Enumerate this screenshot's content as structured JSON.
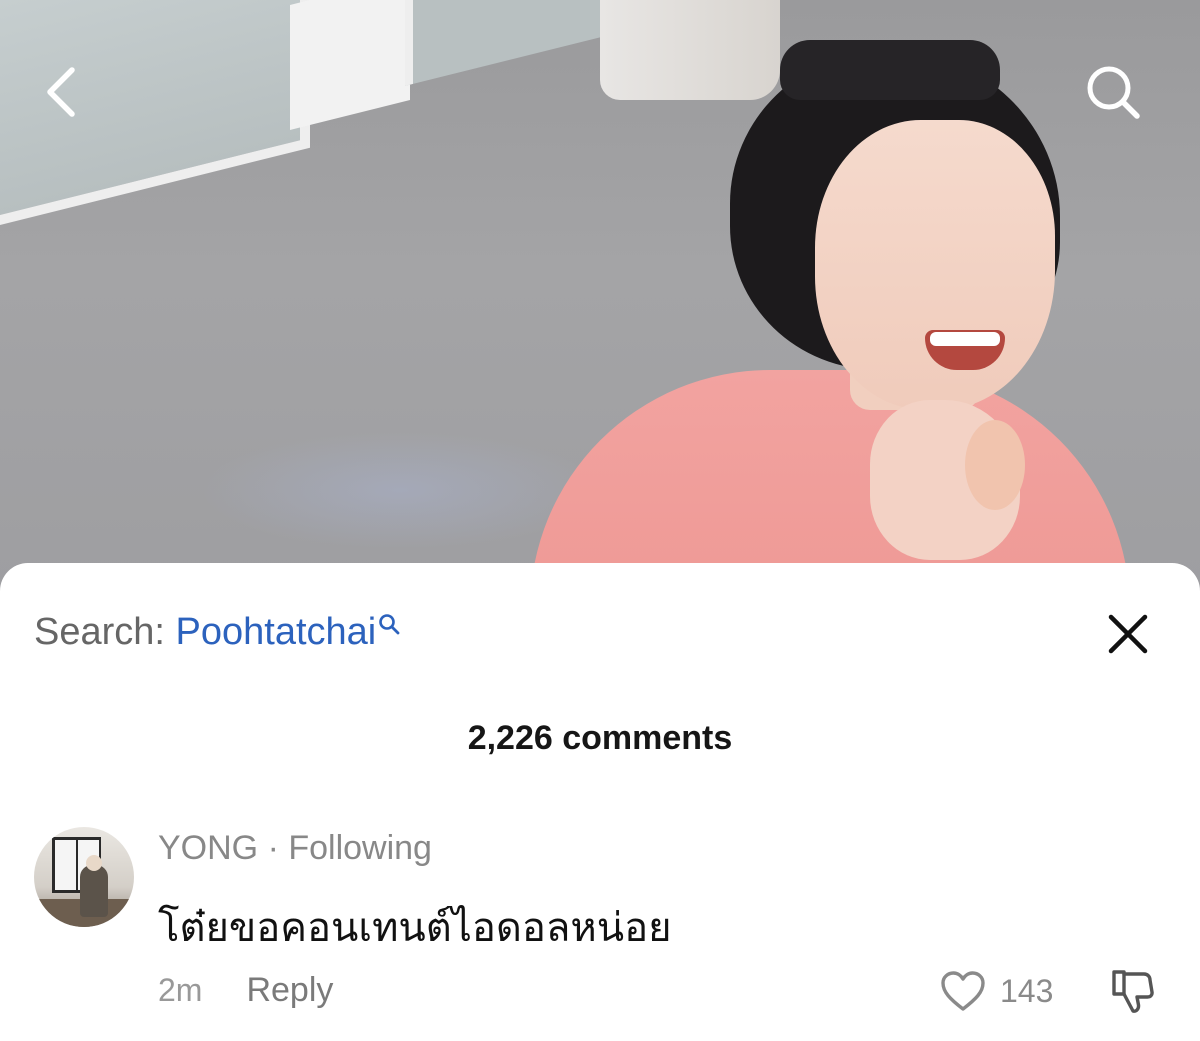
{
  "video": {
    "icons": {
      "back": "chevron-left-icon",
      "search": "search-icon"
    }
  },
  "sheet": {
    "search_prefix": "Search: ",
    "search_term": "Poohtatchai",
    "comment_count": "2,226 comments",
    "comment": {
      "username": "YONG",
      "separator": " · ",
      "relationship": "Following",
      "text": "โต๋ยขอคอนเทนต์ไอดอลหน่อย",
      "time": "2m",
      "reply_label": "Reply",
      "likes": "143"
    }
  },
  "colors": {
    "link_blue": "#2c62bd",
    "meta_gray": "#999999",
    "text_dark": "#111111"
  }
}
